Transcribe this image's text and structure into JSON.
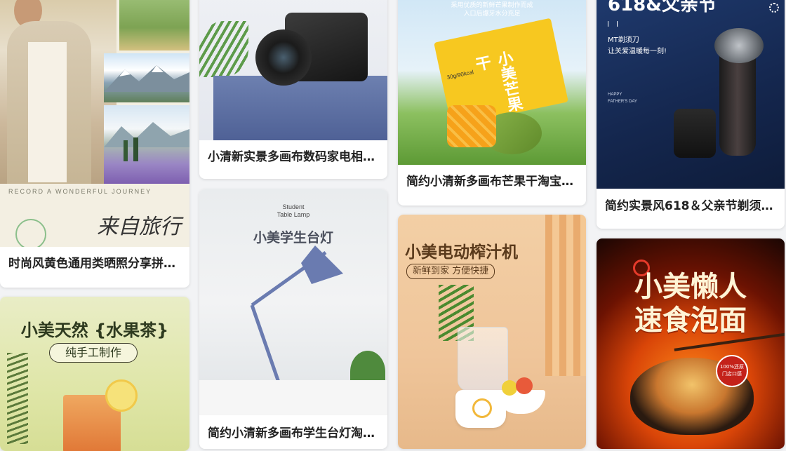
{
  "cards": [
    {
      "title": "时尚风黄色通用类晒照分享拼…",
      "overlay": {
        "subtitle": "RECORD A WONDERFUL JOURNEY",
        "script": "来自旅行"
      }
    },
    {
      "title": "小美天然{水果茶}",
      "overlay": {
        "headline": "小美天然 {水果茶}",
        "tag": "纯手工制作"
      }
    },
    {
      "title": "小清新实景多画布数码家电相…",
      "overlay": {}
    },
    {
      "title": "简约小清新多画布学生台灯淘…",
      "overlay": {
        "en1": "Student",
        "en2": "Table Lamp",
        "headline": "小美学生台灯"
      }
    },
    {
      "title": "简约小清新多画布芒果干淘宝…",
      "overlay": {
        "top1": "采用优质的新鲜芒果制作而成",
        "top2": "入口后爆牙水分充足",
        "package": "小美芒果干",
        "weight": "30g/90kcal"
      }
    },
    {
      "title": "小美电动榨汁机",
      "overlay": {
        "headline": "小美电动榨汁机",
        "tag": "新鲜到家 方便快捷"
      }
    },
    {
      "title": "简约实景风618＆父亲节剃须…",
      "overlay": {
        "headline": "618&父亲节",
        "sub1": "MT剃须刀",
        "sub2": "让关爱温暖每一刻!",
        "en1": "HAPPY",
        "en2": "FATHER'S DAY"
      }
    },
    {
      "title": "小美懒人速食泡面",
      "overlay": {
        "line1": "小美懒人",
        "line2": "速食泡面",
        "badge": "100%还原 门店口感"
      }
    }
  ],
  "colors": {
    "background": "#f2f3f5",
    "card": "#ffffff",
    "title_text": "#222222"
  }
}
